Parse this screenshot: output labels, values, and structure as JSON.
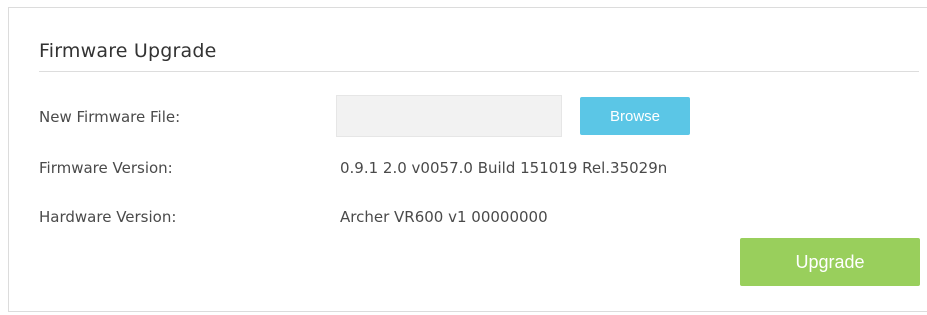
{
  "section": {
    "title": "Firmware Upgrade"
  },
  "fields": {
    "new_firmware_label": "New Firmware File:",
    "new_firmware_value": "",
    "browse_label": "Browse",
    "firmware_version_label": "Firmware Version:",
    "firmware_version_value": "0.9.1 2.0 v0057.0 Build 151019 Rel.35029n",
    "hardware_version_label": "Hardware Version:",
    "hardware_version_value": "Archer VR600 v1 00000000"
  },
  "actions": {
    "upgrade_label": "Upgrade"
  },
  "colors": {
    "browse_button": "#5bc6e6",
    "upgrade_button": "#99cf5c"
  }
}
